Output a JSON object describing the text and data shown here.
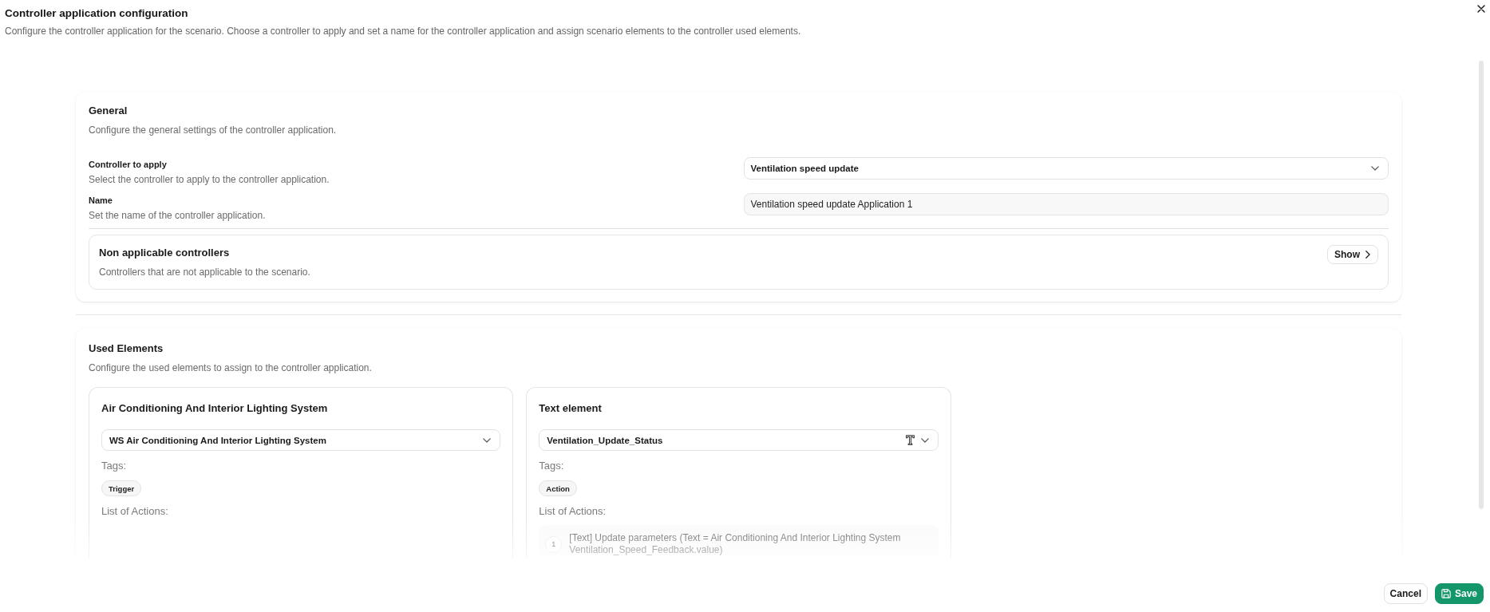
{
  "dialog": {
    "title": "Controller application configuration",
    "description": "Configure the controller application for the scenario. Choose a controller to apply and set a name for the controller application and assign scenario elements to the controller used elements."
  },
  "general": {
    "title": "General",
    "description": "Configure the general settings of the controller application.",
    "fields": [
      {
        "kind": "select",
        "label": "Controller to apply",
        "description": "Select the controller to apply to the controller application.",
        "value": "Ventilation speed update"
      },
      {
        "kind": "input",
        "label": "Name",
        "description": "Set the name of the controller application.",
        "value": "Ventilation speed update Application 1"
      }
    ],
    "non_applicable": {
      "title": "Non applicable controllers",
      "description": "Controllers that are not applicable to the scenario.",
      "button": "Show"
    }
  },
  "used_elements": {
    "title": "Used Elements",
    "description": "Configure the used elements to assign to the controller application.",
    "elements": [
      {
        "kind": "system",
        "title": "Air Conditioning And Interior Lighting System",
        "value": "WS Air Conditioning And Interior Lighting System",
        "tags_label": "Tags:",
        "tags": [
          "Trigger"
        ],
        "actions_label": "List of Actions:"
      },
      {
        "kind": "text",
        "title": "Text element",
        "value": "Ventilation_Update_Status",
        "tags_label": "Tags:",
        "tags": [
          "Action"
        ],
        "actions_label": "List of Actions:",
        "actions": [
          {
            "number": "1",
            "text": "[Text] Update parameters (Text = Air Conditioning And Interior Lighting System Ventilation_Speed_Feedback.value)"
          }
        ]
      }
    ]
  },
  "footer": {
    "buttons": [
      {
        "kind": "secondary",
        "label": "Cancel"
      },
      {
        "kind": "primary",
        "label": "Save"
      }
    ]
  }
}
